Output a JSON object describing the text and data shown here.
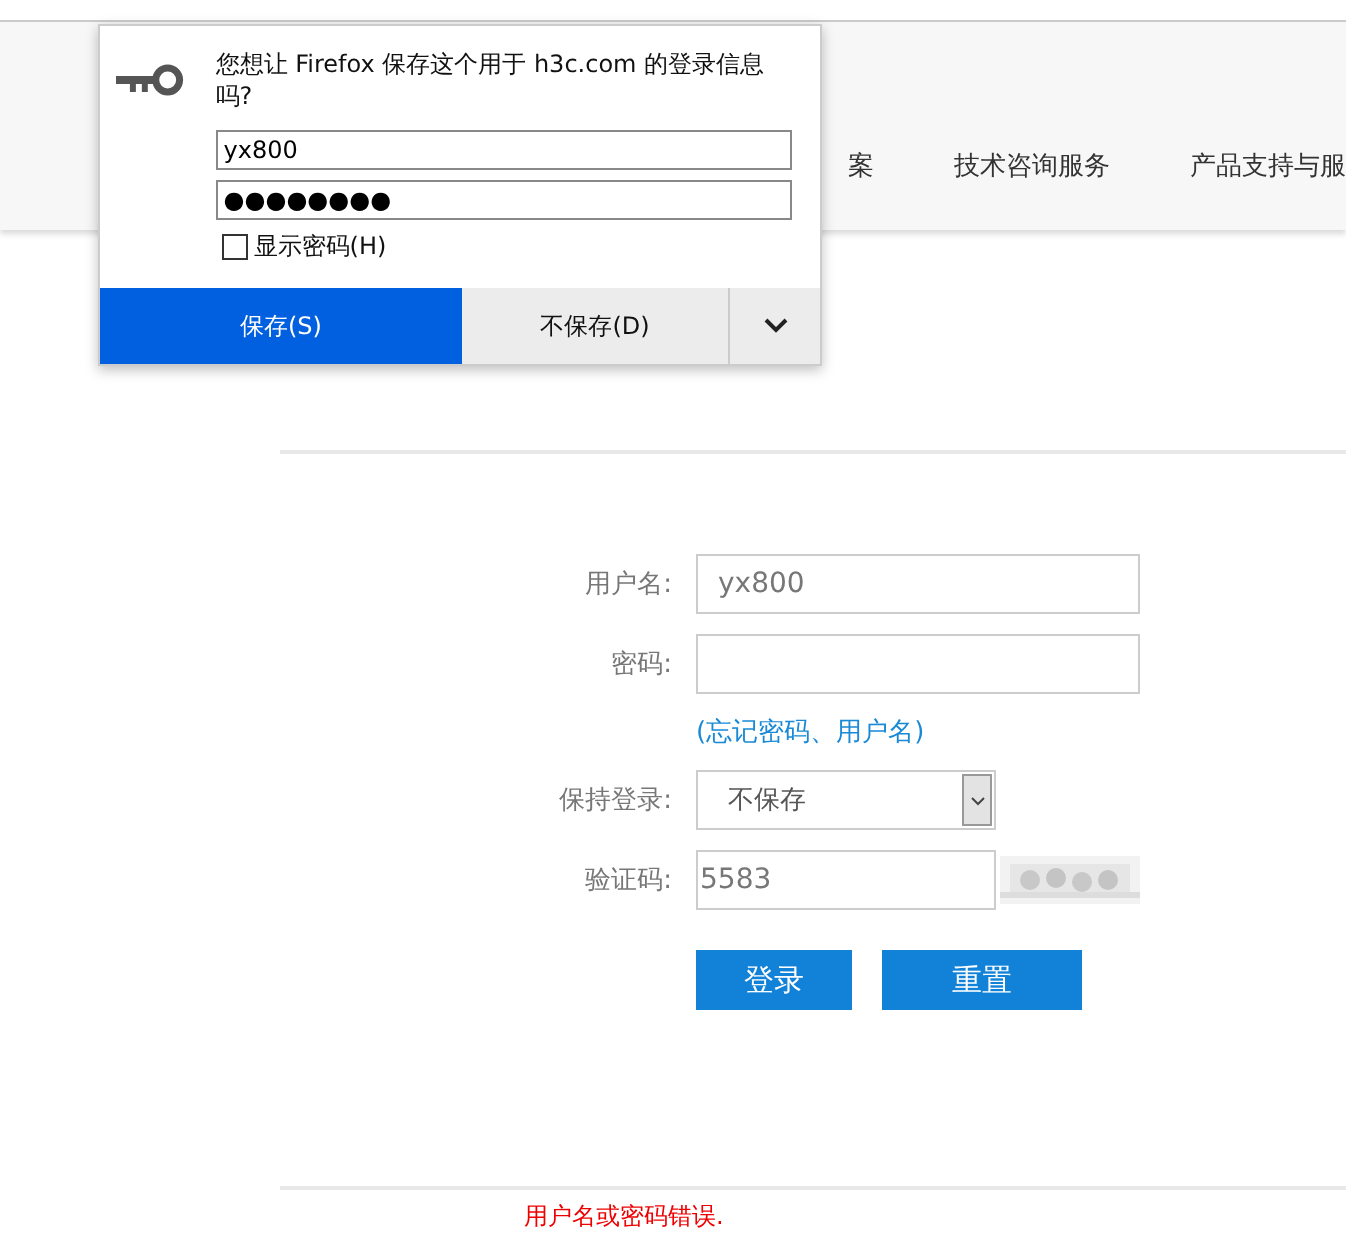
{
  "header": {
    "nav_items": [
      "案",
      "技术咨询服务",
      "产品支持与服"
    ]
  },
  "popup": {
    "message": "您想让 Firefox 保存这个用于 h3c.com 的登录信息吗?",
    "username": "yx800",
    "password": "●●●●●●●●",
    "show_password": {
      "label": "显示密码(H)",
      "checked": false
    },
    "save_button": "保存(S)",
    "dont_save_button": "不保存(D)"
  },
  "form": {
    "username_label": "用户名:",
    "username": "yx800",
    "password_label": "密码:",
    "forgot_link": "(忘记密码、用户名)",
    "keep_login_label": "保持登录:",
    "keep_login_value": "不保存",
    "captcha_label": "验证码:",
    "captcha": "5583",
    "login_button": "登录",
    "reset_button": "重置"
  },
  "error": "用户名或密码错误."
}
